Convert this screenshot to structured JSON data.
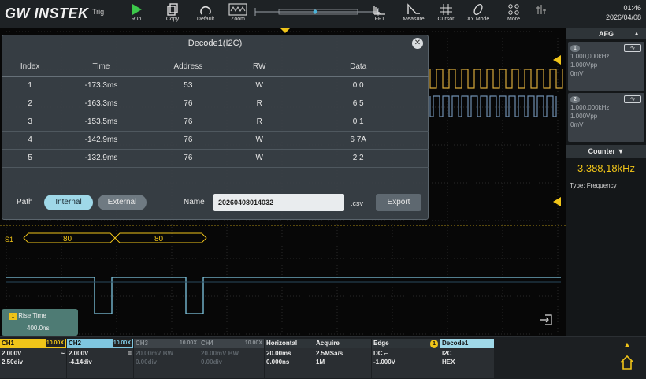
{
  "brand": "GW INSTEK",
  "toolbar": {
    "trig": "Trig",
    "run": "Run",
    "copy": "Copy",
    "default": "Default",
    "zoom": "Zoom",
    "fft": "FFT",
    "measure": "Measure",
    "cursor": "Cursor",
    "xy_mode": "XY Mode",
    "more": "More",
    "time": "01:46",
    "date": "2026/04/08"
  },
  "afg": {
    "title": "AFG",
    "ch1": {
      "num": "1",
      "freq": "1.000,000kHz",
      "amp": "1.000Vpp",
      "offset": "0mV",
      "wave_icon": "sine-icon"
    },
    "ch2": {
      "num": "2",
      "freq": "1.000,000kHz",
      "amp": "1.000Vpp",
      "offset": "0mV",
      "wave_icon": "sine-icon"
    }
  },
  "counter": {
    "title": "Counter",
    "value": "3.388,18kHz",
    "type": "Type: Frequency"
  },
  "decode_dialog": {
    "title": "Decode1(I2C)",
    "columns": [
      "Index",
      "Time",
      "Address",
      "RW",
      "Data"
    ],
    "rows": [
      [
        "1",
        "-173.3ms",
        "53",
        "W",
        "0 0"
      ],
      [
        "2",
        "-163.3ms",
        "76",
        "R",
        "6 5"
      ],
      [
        "3",
        "-153.5ms",
        "76",
        "R",
        "0 1"
      ],
      [
        "4",
        "-142.9ms",
        "76",
        "W",
        "6 7A"
      ],
      [
        "5",
        "-132.9ms",
        "76",
        "W",
        "2 2"
      ]
    ],
    "path_label": "Path",
    "internal": "Internal",
    "external": "External",
    "name_label": "Name",
    "file_name": "20260408014032",
    "ext": ".csv",
    "export": "Export"
  },
  "bus": {
    "label": "S1",
    "val1": "80",
    "val2": "80"
  },
  "rise": {
    "num": "1",
    "label": "Rise Time",
    "value": "400.0ns"
  },
  "channels": {
    "ch1": {
      "name": "CH1",
      "probe": "10.00X",
      "volt": "2.000V",
      "coupling": "~",
      "div": "2.50div"
    },
    "ch2": {
      "name": "CH2",
      "probe": "10.00X",
      "volt": "2.000V",
      "coupling": "=",
      "div": "-4.14div"
    },
    "ch3": {
      "name": "CH3",
      "probe": "10.00X",
      "volt": "20.00mV BW",
      "div": "0.00div"
    },
    "ch4": {
      "name": "CH4",
      "probe": "10.00X",
      "volt": "20.00mV BW",
      "div": "0.00div"
    },
    "horizontal": {
      "name": "Horizontal",
      "scale": "20.00ms",
      "pos": "0.000ns"
    },
    "acquire": {
      "name": "Acquire",
      "rate": "2.5MSa/s",
      "len": "1M"
    },
    "edge": {
      "name": "Edge",
      "num": "1",
      "coupling": "DC",
      "level": "-1.000V"
    },
    "decode": {
      "name": "Decode1",
      "bus": "I2C",
      "format": "HEX"
    }
  },
  "colors": {
    "ch1": "#f0c419",
    "ch2": "#7fc6e0",
    "accent": "#4ab3d9"
  }
}
